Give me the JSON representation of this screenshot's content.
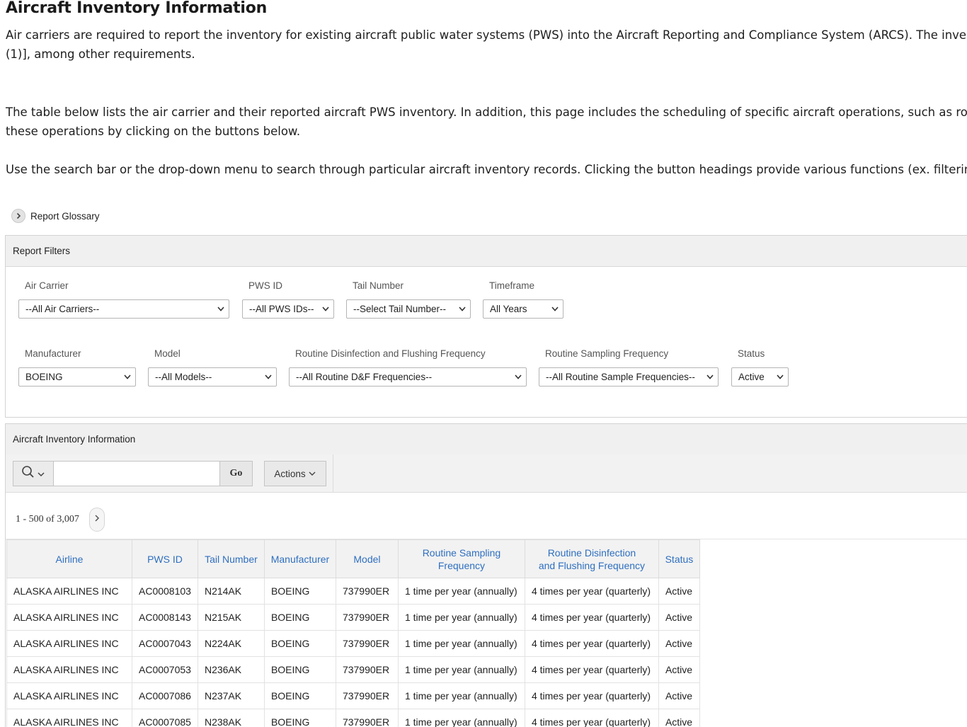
{
  "page": {
    "title": "Aircraft Inventory Information",
    "intro_1a": "Air carriers are required to report the inventory for existing aircraft public water systems (PWS) into the Aircraft Reporting and Compliance System (ARCS). The inventory m",
    "intro_1b": "(1)], among other requirements.",
    "intro_2a": "The table below lists the air carrier and their reported aircraft PWS inventory. In addition, this page includes the scheduling of specific aircraft operations, such as routine d",
    "intro_2b": "these operations by clicking on the buttons below.",
    "intro_3": "Use the search bar or the drop-down menu to search through particular aircraft inventory records. Clicking the button headings provide various functions (ex. filtering the"
  },
  "glossary": {
    "label": "Report Glossary"
  },
  "filters": {
    "title": "Report Filters",
    "air_carrier": {
      "label": "Air Carrier",
      "value": "--All Air Carriers--"
    },
    "pws_id": {
      "label": "PWS ID",
      "value": "--All PWS IDs--"
    },
    "tail_number": {
      "label": "Tail Number",
      "value": "--Select Tail Number--"
    },
    "timeframe": {
      "label": "Timeframe",
      "value": "All Years"
    },
    "manufacturer": {
      "label": "Manufacturer",
      "value": "BOEING"
    },
    "model": {
      "label": "Model",
      "value": "--All Models--"
    },
    "dnf_frequency": {
      "label": "Routine Disinfection and Flushing Frequency",
      "value": "--All Routine D&F Frequencies--"
    },
    "sampling_frequency": {
      "label": "Routine Sampling Frequency",
      "value": "--All Routine Sample Frequencies--"
    },
    "status": {
      "label": "Status",
      "value": "Active"
    }
  },
  "inventory": {
    "title": "Aircraft Inventory Information",
    "go_label": "Go",
    "actions_label": "Actions",
    "search_placeholder": "",
    "pagination": "1 - 500 of 3,007",
    "columns": {
      "airline": "Airline",
      "pws_id": "PWS ID",
      "tail": "Tail Number",
      "manufacturer": "Manufacturer",
      "model": "Model",
      "sampling_1": "Routine Sampling",
      "sampling_2": "Frequency",
      "dnf_1": "Routine Disinfection",
      "dnf_2": "and Flushing Frequency",
      "status": "Status"
    },
    "rows": [
      {
        "airline": "ALASKA AIRLINES INC",
        "pws_id": "AC0008103",
        "tail": "N214AK",
        "manufacturer": "BOEING",
        "model": "737990ER",
        "sampling": "1 time per year (annually)",
        "dnf": "4 times per year (quarterly)",
        "status": "Active"
      },
      {
        "airline": "ALASKA AIRLINES INC",
        "pws_id": "AC0008143",
        "tail": "N215AK",
        "manufacturer": "BOEING",
        "model": "737990ER",
        "sampling": "1 time per year (annually)",
        "dnf": "4 times per year (quarterly)",
        "status": "Active"
      },
      {
        "airline": "ALASKA AIRLINES INC",
        "pws_id": "AC0007043",
        "tail": "N224AK",
        "manufacturer": "BOEING",
        "model": "737990ER",
        "sampling": "1 time per year (annually)",
        "dnf": "4 times per year (quarterly)",
        "status": "Active"
      },
      {
        "airline": "ALASKA AIRLINES INC",
        "pws_id": "AC0007053",
        "tail": "N236AK",
        "manufacturer": "BOEING",
        "model": "737990ER",
        "sampling": "1 time per year (annually)",
        "dnf": "4 times per year (quarterly)",
        "status": "Active"
      },
      {
        "airline": "ALASKA AIRLINES INC",
        "pws_id": "AC0007086",
        "tail": "N237AK",
        "manufacturer": "BOEING",
        "model": "737990ER",
        "sampling": "1 time per year (annually)",
        "dnf": "4 times per year (quarterly)",
        "status": "Active"
      },
      {
        "airline": "ALASKA AIRLINES INC",
        "pws_id": "AC0007085",
        "tail": "N238AK",
        "manufacturer": "BOEING",
        "model": "737990ER",
        "sampling": "1 time per year (annually)",
        "dnf": "4 times per year (quarterly)",
        "status": "Active"
      }
    ]
  },
  "icons": {
    "glossary": "chevron-right-icon",
    "search": "search-icon",
    "dropdown": "chevron-down-icon",
    "next_page": "chevron-right-icon"
  },
  "colors": {
    "header_link": "#2f6fbf",
    "region_header": "#f0f0f0",
    "border": "#d3d3d3"
  }
}
